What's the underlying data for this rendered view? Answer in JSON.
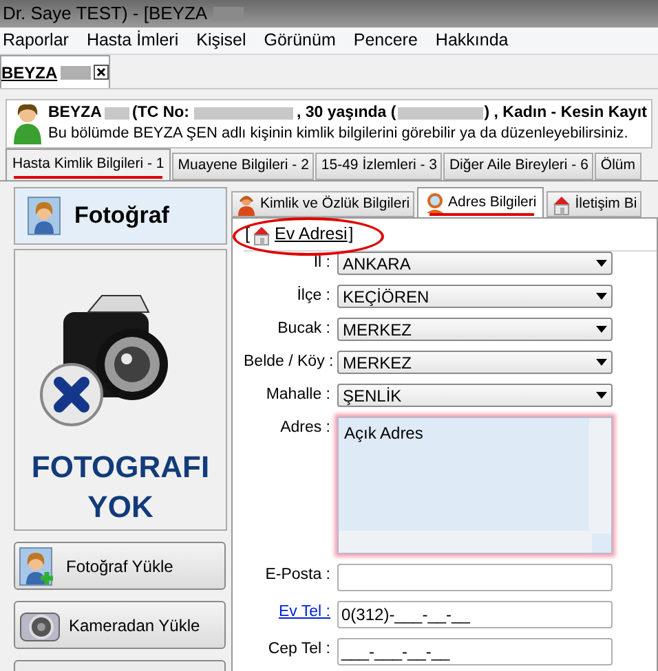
{
  "window": {
    "title": "Dr. Saye TEST) - [BEYZA"
  },
  "menu": [
    "Raporlar",
    "Hasta İmleri",
    "Kişisel",
    "Görünüm",
    "Pencere",
    "Hakkında"
  ],
  "document_tab": {
    "label": "BEYZA"
  },
  "patient": {
    "name": "BEYZA",
    "id_label": "(TC No:",
    "age": ", 30 yaşında (",
    "summary": ") , Kadın - Kesin Kayıt",
    "description": "Bu bölümde BEYZA ŞEN adlı kişinin kimlik bilgilerini görebilir ya da düzenleyebilirsiniz."
  },
  "main_tabs": [
    {
      "label": "Hasta Kimlik Bilgileri - 1",
      "selected": true
    },
    {
      "label": "Muayene Bilgileri - 2",
      "selected": false
    },
    {
      "label": "15-49 İzlemleri - 3",
      "selected": false
    },
    {
      "label": "Diğer Aile Bireyleri - 6",
      "selected": false
    },
    {
      "label": "Ölüm",
      "selected": false
    }
  ],
  "photo_panel": {
    "title": "Fotoğraf",
    "no_photo": "FOTOGRAFI YOK"
  },
  "photo_buttons": [
    {
      "label": "Fotoğraf Yükle",
      "kind": "upload"
    },
    {
      "label": "Kameradan Yükle",
      "kind": "camera"
    }
  ],
  "sub_tabs": [
    {
      "label": "Kimlik ve Özlük Bilgileri",
      "kind": "person",
      "selected": false
    },
    {
      "label": "Adres Bilgileri",
      "kind": "search",
      "selected": true
    },
    {
      "label": "İletişim Bi",
      "kind": "house",
      "selected": false
    }
  ],
  "group": {
    "open": "[",
    "title": "Ev Adresi",
    "close": "]"
  },
  "fields": [
    {
      "label": "İl :",
      "kind": "select",
      "value": "ANKARA"
    },
    {
      "label": "İlçe :",
      "kind": "select",
      "value": "KEÇİÖREN"
    },
    {
      "label": "Bucak :",
      "kind": "select",
      "value": "MERKEZ"
    },
    {
      "label": "Belde / Köy :",
      "kind": "select",
      "value": "MERKEZ"
    },
    {
      "label": "Mahalle :",
      "kind": "select",
      "value": "ŞENLİK"
    },
    {
      "label": "Adres :",
      "kind": "textarea",
      "value": "Açık Adres"
    },
    {
      "label": "E-Posta :",
      "kind": "text"
    },
    {
      "label": "Ev Tel :",
      "kind": "text",
      "link": true,
      "value": "0(312)-___-__-__"
    },
    {
      "label": "Cep Tel :",
      "kind": "text",
      "value": "___-___-__-__"
    }
  ]
}
